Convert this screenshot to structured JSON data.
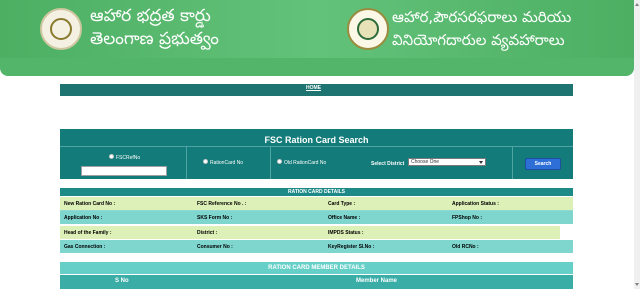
{
  "header": {
    "left_line1": "ఆహార భద్రత కార్డు",
    "left_line2": "తెలంగాణ ప్రభుత్వం",
    "right_line1": "ఆహార,పౌరసరఫరాలు మరియు",
    "right_line2": "వినియోగదారుల వ్యవహారాలు",
    "left_emblem_icon": "telangana-emblem-icon",
    "right_emblem_icon": "civil-supplies-logo-icon"
  },
  "nav": {
    "home": "HOME"
  },
  "search": {
    "title": "FSC Ration Card Search",
    "options": [
      "FSCRefNo",
      "RationCard No",
      "Old RationCard No"
    ],
    "district_label": "Select District",
    "district_selected": "Choose One",
    "button": "Search"
  },
  "details": {
    "title": "RATION CARD DETAILS",
    "rows": [
      [
        "New Ration Card No :",
        "FSC Reference No . :",
        "Card Type :",
        "Application Status :"
      ],
      [
        "Application No :",
        "SKS Form No :",
        "Office Name :",
        "FPShop No :"
      ],
      [
        "Head of the Family :",
        "District :",
        "IMPDS Status :",
        ""
      ],
      [
        "Gas Connection :",
        "Consumer No :",
        "KeyRegister Sl.No :",
        "Old RCNo :"
      ]
    ]
  },
  "members": {
    "title": "RATION CARD MEMBER DETAILS",
    "columns": [
      "S No",
      "Member Name"
    ]
  },
  "colors": {
    "header_green": "#52b56a",
    "teal_dark": "#137b79",
    "row_light": "#ddf0b8",
    "row_teal": "#7ed6cf",
    "button_blue": "#2d6fd6"
  }
}
